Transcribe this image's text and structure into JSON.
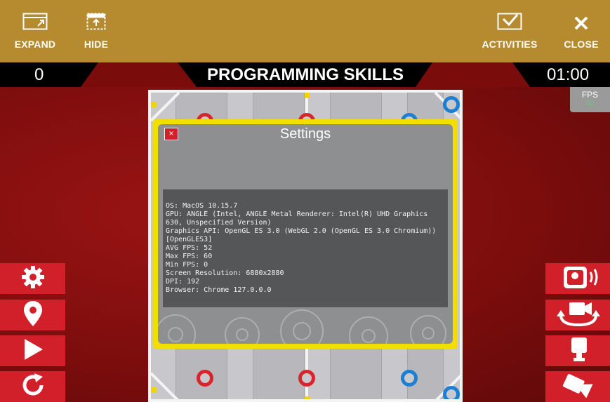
{
  "toolbar": {
    "expand_label": "EXPAND",
    "hide_label": "HIDE",
    "activities_label": "ACTIVITIES",
    "close_label": "CLOSE"
  },
  "scoreboard": {
    "score": "0",
    "title": "PROGRAMMING SKILLS",
    "timer": "01:00"
  },
  "fps_panel": {
    "label": "FPS",
    "value": "60"
  },
  "settings": {
    "title": "Settings",
    "close_glyph": "×",
    "info_lines": [
      "OS: MacOS 10.15.7",
      "GPU: ANGLE (Intel, ANGLE Metal Renderer: Intel(R) UHD Graphics 630, Unspecified Version)",
      "Graphics API: OpenGL ES 3.0 (WebGL 2.0 (OpenGL ES 3.0 Chromium)) [OpenGLES3]",
      "AVG FPS: 52",
      "Max FPS: 60",
      "Min FPS: 0",
      "Screen Resolution: 6880x2880",
      "DPI: 192",
      "Browser: Chrome 127.0.0.0"
    ]
  },
  "left_controls": [
    "gear-icon",
    "location-pin-icon",
    "play-icon",
    "reset-icon"
  ],
  "right_controls": [
    "robot-sensor-icon",
    "rotate-camera-icon",
    "top-view-icon",
    "camera-icon"
  ],
  "colors": {
    "toolbar": "#b68a2f",
    "control_red": "#d2202a",
    "modal_border": "#f6dd00",
    "ring_red": "#d9232d",
    "ring_blue": "#1c7fd3"
  }
}
